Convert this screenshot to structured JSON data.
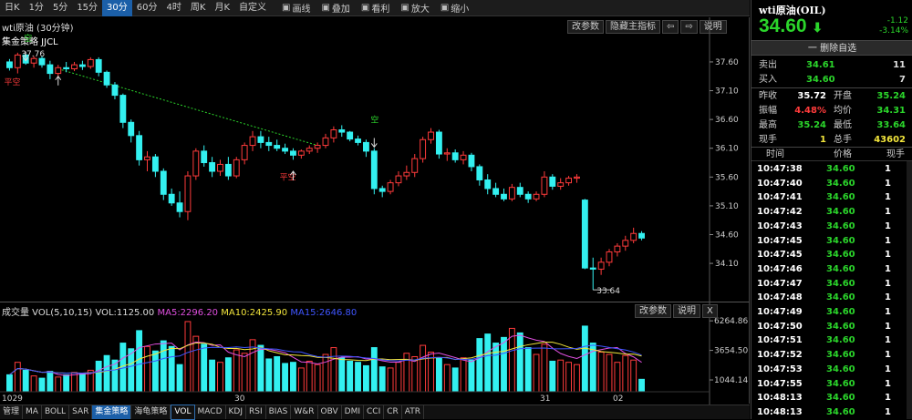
{
  "toolbar": {
    "periods": [
      "日K",
      "1分",
      "5分",
      "15分",
      "30分",
      "60分",
      "4时",
      "周K",
      "月K",
      "自定义"
    ],
    "active_period": "30分",
    "tools": [
      {
        "label": "画线",
        "icon": "pen-icon"
      },
      {
        "label": "叠加",
        "icon": "overlay-icon"
      },
      {
        "label": "看利",
        "icon": "profit-icon"
      },
      {
        "label": "放大",
        "icon": "zoom-in-icon"
      },
      {
        "label": "缩小",
        "icon": "zoom-out-icon"
      }
    ]
  },
  "main_chart": {
    "title": "wti原油 (30分钟)",
    "strategy_label": "集金策略 JJCL",
    "buttons": {
      "params": "改参数",
      "hide": "隐藏主指标",
      "prev": "⇦",
      "next": "⇨",
      "help": "说明"
    },
    "y_ticks": [
      "37.60",
      "37.10",
      "36.60",
      "36.10",
      "35.60",
      "35.10",
      "34.60",
      "34.10"
    ],
    "annotations": {
      "high": "37.76",
      "low": "33.64",
      "short": "空",
      "flat": "平空"
    },
    "up_color": "#ff3b3b",
    "down_color": "#33f0f0"
  },
  "chart_data": {
    "type": "candlestick",
    "ylim": [
      33.5,
      37.9
    ],
    "candles": [
      [
        37.6,
        37.65,
        37.45,
        37.5
      ],
      [
        37.5,
        37.76,
        37.4,
        37.72
      ],
      [
        37.72,
        37.74,
        37.55,
        37.58
      ],
      [
        37.58,
        37.7,
        37.5,
        37.66
      ],
      [
        37.66,
        37.7,
        37.5,
        37.55
      ],
      [
        37.55,
        37.62,
        37.3,
        37.4
      ],
      [
        37.4,
        37.55,
        37.35,
        37.5
      ],
      [
        37.5,
        37.6,
        37.42,
        37.48
      ],
      [
        37.48,
        37.6,
        37.44,
        37.55
      ],
      [
        37.55,
        37.62,
        37.46,
        37.52
      ],
      [
        37.52,
        37.68,
        37.48,
        37.64
      ],
      [
        37.64,
        37.68,
        37.35,
        37.42
      ],
      [
        37.42,
        37.45,
        37.15,
        37.2
      ],
      [
        37.2,
        37.25,
        36.95,
        37.02
      ],
      [
        37.02,
        37.05,
        36.45,
        36.55
      ],
      [
        36.55,
        36.6,
        36.2,
        36.32
      ],
      [
        36.32,
        36.4,
        35.8,
        35.9
      ],
      [
        35.9,
        36.05,
        35.7,
        35.95
      ],
      [
        35.95,
        36.0,
        35.6,
        35.7
      ],
      [
        35.7,
        35.75,
        35.2,
        35.3
      ],
      [
        35.3,
        35.4,
        35.1,
        35.15
      ],
      [
        35.15,
        35.35,
        34.9,
        35.0
      ],
      [
        35.0,
        35.7,
        34.85,
        35.62
      ],
      [
        35.62,
        36.1,
        35.55,
        36.05
      ],
      [
        36.05,
        36.15,
        35.78,
        35.85
      ],
      [
        35.85,
        35.95,
        35.6,
        35.7
      ],
      [
        35.7,
        35.9,
        35.62,
        35.82
      ],
      [
        35.82,
        35.95,
        35.55,
        35.62
      ],
      [
        35.62,
        35.95,
        35.58,
        35.9
      ],
      [
        35.9,
        36.2,
        35.82,
        36.15
      ],
      [
        36.15,
        36.4,
        36.05,
        36.3
      ],
      [
        36.3,
        36.4,
        36.1,
        36.2
      ],
      [
        36.2,
        36.3,
        36.05,
        36.15
      ],
      [
        36.15,
        36.25,
        36.05,
        36.1
      ],
      [
        36.1,
        36.18,
        36.0,
        36.05
      ],
      [
        36.05,
        36.1,
        35.9,
        35.98
      ],
      [
        35.98,
        36.08,
        35.92,
        36.05
      ],
      [
        36.05,
        36.15,
        36.0,
        36.1
      ],
      [
        36.1,
        36.2,
        36.02,
        36.15
      ],
      [
        36.15,
        36.35,
        36.1,
        36.28
      ],
      [
        36.28,
        36.48,
        36.2,
        36.42
      ],
      [
        36.42,
        36.5,
        36.3,
        36.38
      ],
      [
        36.38,
        36.4,
        36.22,
        36.26
      ],
      [
        36.26,
        36.32,
        36.15,
        36.2
      ],
      [
        36.2,
        36.25,
        35.95,
        36.05
      ],
      [
        36.05,
        36.1,
        35.3,
        35.4
      ],
      [
        35.4,
        35.45,
        35.25,
        35.35
      ],
      [
        35.35,
        35.55,
        35.3,
        35.5
      ],
      [
        35.5,
        35.7,
        35.44,
        35.62
      ],
      [
        35.62,
        35.8,
        35.55,
        35.68
      ],
      [
        35.68,
        36.0,
        35.6,
        35.92
      ],
      [
        35.92,
        36.3,
        35.85,
        36.25
      ],
      [
        36.25,
        36.45,
        36.18,
        36.38
      ],
      [
        36.38,
        36.42,
        35.92,
        36.0
      ],
      [
        36.0,
        36.1,
        35.88,
        36.02
      ],
      [
        36.02,
        36.08,
        35.85,
        35.9
      ],
      [
        35.9,
        36.05,
        35.82,
        35.98
      ],
      [
        35.98,
        36.02,
        35.7,
        35.78
      ],
      [
        35.78,
        35.82,
        35.45,
        35.55
      ],
      [
        35.55,
        35.65,
        35.3,
        35.4
      ],
      [
        35.4,
        35.5,
        35.25,
        35.3
      ],
      [
        35.3,
        35.4,
        35.18,
        35.22
      ],
      [
        35.22,
        35.48,
        35.18,
        35.42
      ],
      [
        35.42,
        35.5,
        35.25,
        35.3
      ],
      [
        35.3,
        35.35,
        35.15,
        35.22
      ],
      [
        35.22,
        35.35,
        35.18,
        35.3
      ],
      [
        35.3,
        35.7,
        35.25,
        35.6
      ],
      [
        35.6,
        35.65,
        35.38,
        35.44
      ],
      [
        35.44,
        35.58,
        35.38,
        35.5
      ],
      [
        35.5,
        35.62,
        35.45,
        35.58
      ],
      [
        35.58,
        35.65,
        35.5,
        35.6
      ],
      [
        35.2,
        35.22,
        34.0,
        34.02
      ],
      [
        34.02,
        34.2,
        33.64,
        34.0
      ],
      [
        34.0,
        34.2,
        33.9,
        34.12
      ],
      [
        34.12,
        34.35,
        34.05,
        34.3
      ],
      [
        34.3,
        34.45,
        34.22,
        34.4
      ],
      [
        34.4,
        34.58,
        34.32,
        34.5
      ],
      [
        34.5,
        34.72,
        34.45,
        34.62
      ],
      [
        34.62,
        34.66,
        34.5,
        34.54
      ]
    ]
  },
  "volume_chart": {
    "title": "成交量 VOL(5,10,15)",
    "vol": "VOL:1125.00",
    "ma5": "MA5:2296.20",
    "ma10": "MA10:2425.90",
    "ma15": "MA15:2646.80",
    "buttons": {
      "params": "改参数",
      "help": "说明",
      "close": "X"
    },
    "y_ticks": [
      "6264.86",
      "3654.50",
      "1044.14"
    ],
    "x_labels": [
      "1029",
      "30",
      "31",
      "02"
    ],
    "ma5_color": "#e04fe0",
    "ma10_color": "#f2e53c",
    "ma15_color": "#3f55ff",
    "volumes": [
      1500,
      2600,
      1900,
      1400,
      1200,
      1800,
      1300,
      1500,
      1700,
      1600,
      1900,
      2700,
      3200,
      2800,
      4300,
      3800,
      5400,
      4000,
      3600,
      4500,
      4000,
      2400,
      6200,
      4900,
      4200,
      2800,
      2600,
      3000,
      3700,
      3400,
      4600,
      4100,
      2900,
      3100,
      2500,
      2600,
      2100,
      2700,
      2400,
      3300,
      3900,
      3000,
      2700,
      2600,
      2300,
      3900,
      2200,
      2100,
      2600,
      3400,
      3100,
      4100,
      3500,
      3000,
      2400,
      2100,
      3000,
      2800,
      4700,
      5100,
      4300,
      4800,
      5600,
      5200,
      3900,
      3300,
      4200,
      2700,
      2800,
      2600,
      2400,
      5800,
      4300,
      3500,
      3300,
      2600,
      3200,
      2800,
      1100
    ]
  },
  "bottombar": {
    "items": [
      "管理",
      "MA",
      "BOLL",
      "SAR",
      "集金策略",
      "海龟策略",
      "VOL",
      "MACD",
      "KDJ",
      "RSI",
      "BIAS",
      "W&R",
      "OBV",
      "DMI",
      "CCI",
      "CR",
      "ATR"
    ],
    "active": "集金策略",
    "selected": "VOL"
  },
  "quote": {
    "title": "wti原油(OIL)",
    "price": "34.60",
    "arrow": "⬇",
    "change": "-1.12",
    "change_pct": "-3.14%",
    "watch": "一 删除自选",
    "ask": {
      "label": "卖出",
      "price": "34.61",
      "vol": "11"
    },
    "bid": {
      "label": "买入",
      "price": "34.60",
      "vol": "7"
    },
    "stats": [
      {
        "l1": "昨收",
        "v1": "35.72",
        "c1": "#ffffff",
        "l2": "开盘",
        "v2": "35.24",
        "c2": "#2bd52b"
      },
      {
        "l1": "振幅",
        "v1": "4.48%",
        "c1": "#ff3b3b",
        "l2": "均价",
        "v2": "34.31",
        "c2": "#2bd52b"
      },
      {
        "l1": "最高",
        "v1": "35.24",
        "c1": "#2bd52b",
        "l2": "最低",
        "v2": "33.64",
        "c2": "#2bd52b"
      },
      {
        "l1": "现手",
        "v1": "1",
        "c1": "#f2e53c",
        "l2": "总手",
        "v2": "43602",
        "c2": "#f2e53c"
      }
    ],
    "ticks_header": {
      "time": "时间",
      "price": "价格",
      "vol": "现手"
    },
    "ticks": [
      {
        "time": "10:47:38",
        "price": "34.60",
        "vol": "1"
      },
      {
        "time": "10:47:40",
        "price": "34.60",
        "vol": "1"
      },
      {
        "time": "10:47:41",
        "price": "34.60",
        "vol": "1"
      },
      {
        "time": "10:47:42",
        "price": "34.60",
        "vol": "1"
      },
      {
        "time": "10:47:43",
        "price": "34.60",
        "vol": "1"
      },
      {
        "time": "10:47:45",
        "price": "34.60",
        "vol": "1"
      },
      {
        "time": "10:47:45",
        "price": "34.60",
        "vol": "1"
      },
      {
        "time": "10:47:46",
        "price": "34.60",
        "vol": "1"
      },
      {
        "time": "10:47:47",
        "price": "34.60",
        "vol": "1"
      },
      {
        "time": "10:47:48",
        "price": "34.60",
        "vol": "1"
      },
      {
        "time": "10:47:49",
        "price": "34.60",
        "vol": "1"
      },
      {
        "time": "10:47:50",
        "price": "34.60",
        "vol": "1"
      },
      {
        "time": "10:47:51",
        "price": "34.60",
        "vol": "1"
      },
      {
        "time": "10:47:52",
        "price": "34.60",
        "vol": "1"
      },
      {
        "time": "10:47:53",
        "price": "34.60",
        "vol": "1"
      },
      {
        "time": "10:47:55",
        "price": "34.60",
        "vol": "1"
      },
      {
        "time": "10:48:13",
        "price": "34.60",
        "vol": "1"
      },
      {
        "time": "10:48:13",
        "price": "34.60",
        "vol": "1"
      }
    ]
  }
}
